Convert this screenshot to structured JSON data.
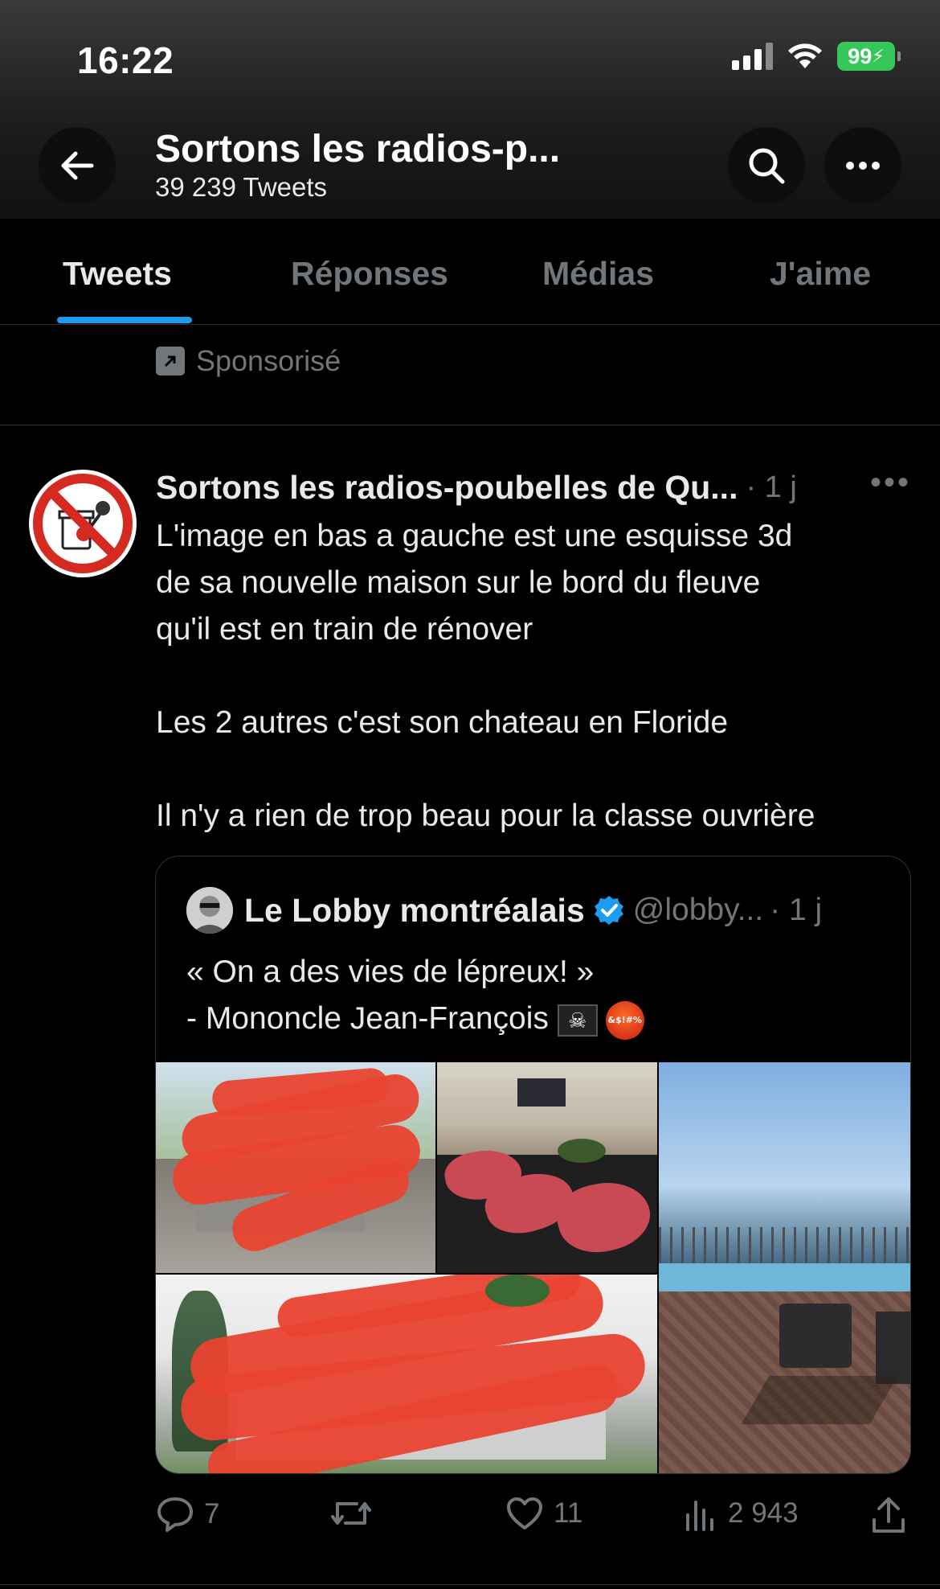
{
  "status_bar": {
    "time": "16:22",
    "battery": "99"
  },
  "header": {
    "title": "Sortons les radios-p...",
    "subtitle": "39 239 Tweets"
  },
  "tabs": [
    {
      "label": "Tweets",
      "active": true
    },
    {
      "label": "Réponses",
      "active": false
    },
    {
      "label": "Médias",
      "active": false
    },
    {
      "label": "J'aime",
      "active": false
    }
  ],
  "sponsored": {
    "label": "Sponsorisé"
  },
  "tweet": {
    "author": "Sortons les radios-poubelles de Qu...",
    "time": "· 1 j",
    "text": "L'image en bas a gauche est une esquisse 3d\nde sa nouvelle maison sur le bord du fleuve\nqu'il est en train de rénover\n\nLes 2 autres c'est son chateau en Floride\n\nIl n'y a rien de trop beau pour la classe ouvrière",
    "quote": {
      "author": "Le Lobby montréalais",
      "handle": "@lobby...",
      "time": "· 1 j",
      "line1": "« On a des vies de lépreux! »",
      "line2": "- Mononcle Jean-François",
      "emoji_face_text": "&$!#%"
    },
    "actions": {
      "replies": "7",
      "retweets": "",
      "likes": "11",
      "views": "2 943"
    }
  },
  "colors": {
    "accent": "#1d9bf0",
    "muted": "#71767b",
    "text": "#e7e9ea",
    "background": "#000000",
    "battery": "#35c759"
  }
}
